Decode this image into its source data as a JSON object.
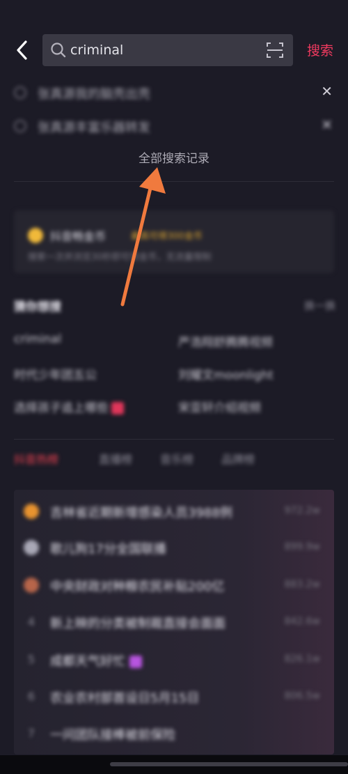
{
  "header": {
    "search_value": "criminal",
    "search_action": "搜索"
  },
  "history": {
    "items": [
      {
        "label": "张真源我的脑壳出壳"
      },
      {
        "label": "张真源丰富乐器转发"
      }
    ],
    "all_label": "全部搜索记录"
  },
  "vip": {
    "title": "抖音畅金币",
    "tag": "最高可得300金币",
    "subtitle": "搜索一次并浏览30秒即可领金币，无流量限制"
  },
  "guess": {
    "title": "猜你想搜",
    "refresh": "换一换",
    "items": [
      {
        "label": "criminal"
      },
      {
        "label": "严浩翔舒腾腾视频"
      },
      {
        "label": "时代少年团五公"
      },
      {
        "label": "刘耀文moonlight"
      },
      {
        "label": "选择孩子追上哪些"
      },
      {
        "label": "宋亚轩介绍视频"
      }
    ]
  },
  "tabs": [
    {
      "label": "抖音热榜",
      "active": true
    },
    {
      "label": "直播榜",
      "active": false
    },
    {
      "label": "音乐榜",
      "active": false
    },
    {
      "label": "品牌榜",
      "active": false
    }
  ],
  "hot_list": {
    "items": [
      {
        "rank": "1",
        "text": "吉林省近期新增感染人员3988例",
        "count": "972.2w"
      },
      {
        "rank": "2",
        "text": "歌儿狗17分全国联播",
        "count": "899.9w"
      },
      {
        "rank": "3",
        "text": "中央财政对种粮农民补贴200亿",
        "count": "883.2w"
      },
      {
        "rank": "4",
        "text": "新上映的分类被制裁直接会面面",
        "count": "842.6w"
      },
      {
        "rank": "5",
        "text": "成都天气好忙",
        "count": "826.1w"
      },
      {
        "rank": "6",
        "text": "农业农村部首设日5月15日",
        "count": "806.5w"
      },
      {
        "rank": "7",
        "text": "一问团队接棒被前保险",
        "count": ""
      }
    ]
  },
  "colors": {
    "background": "#1c1b26",
    "accent": "#f03a5f",
    "annotation_arrow": "#f07a3e"
  },
  "icons": {
    "back": "chevron-left-icon",
    "search": "search-icon",
    "scan": "scan-icon",
    "history": "clock-icon",
    "close": "close-icon"
  }
}
